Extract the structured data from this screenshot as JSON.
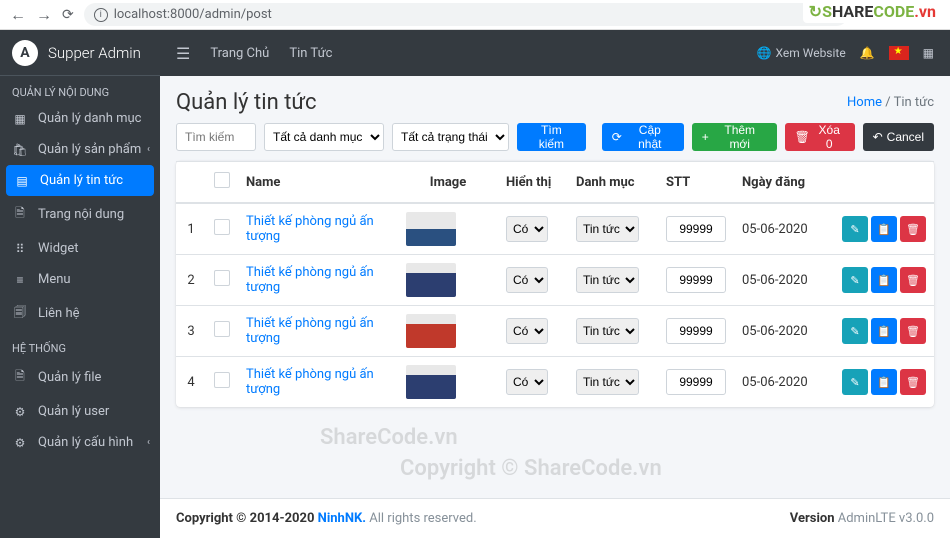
{
  "browser": {
    "url": "localhost:8000/admin/post"
  },
  "brand": "Supper Admin",
  "sidebar": {
    "section1": "QUẢN LÝ NỘI DUNG",
    "items1": [
      {
        "label": "Quản lý danh mục",
        "icon": "▦"
      },
      {
        "label": "Quản lý sản phẩm",
        "icon": "🛍",
        "chev": "‹"
      },
      {
        "label": "Quản lý tin tức",
        "icon": "▤",
        "active": true
      },
      {
        "label": "Trang nội dung",
        "icon": "🗎"
      },
      {
        "label": "Widget",
        "icon": "⠿"
      },
      {
        "label": "Menu",
        "icon": "≡"
      },
      {
        "label": "Liên hệ",
        "icon": "🗐"
      }
    ],
    "section2": "HỆ THỐNG",
    "items2": [
      {
        "label": "Quản lý file",
        "icon": "🗎"
      },
      {
        "label": "Quản lý user",
        "icon": "⚙"
      },
      {
        "label": "Quản lý cấu hình",
        "icon": "⚙",
        "chev": "‹"
      }
    ]
  },
  "topbar": {
    "links": [
      "Trang Chủ",
      "Tin Tức"
    ],
    "xem": "Xem Website"
  },
  "page": {
    "title": "Quản lý tin tức",
    "crumb_home": "Home",
    "crumb_current": "Tin tức"
  },
  "filters": {
    "search_ph": "Tìm kiếm",
    "cat": "Tất cả danh mục",
    "status": "Tất cả trạng thái",
    "search_btn": "Tìm kiếm",
    "update": "Cập nhật",
    "add": "Thêm mới",
    "del": "Xóa 0",
    "cancel": "Cancel"
  },
  "table": {
    "headers": [
      "",
      "",
      "Name",
      "Image",
      "Hiển thị",
      "Danh mục",
      "STT",
      "Ngày đăng",
      ""
    ],
    "rows": [
      {
        "idx": "1",
        "name": "Thiết kế phòng ngủ ấn tượng",
        "show": "Có",
        "cat": "Tin tức",
        "stt": "99999",
        "date": "05-06-2020",
        "thumb": "blue"
      },
      {
        "idx": "2",
        "name": "Thiết kế phòng ngủ ấn tượng",
        "show": "Có",
        "cat": "Tin tức",
        "stt": "99999",
        "date": "05-06-2020",
        "thumb": "navy"
      },
      {
        "idx": "3",
        "name": "Thiết kế phòng ngủ ấn tượng",
        "show": "Có",
        "cat": "Tin tức",
        "stt": "99999",
        "date": "05-06-2020",
        "thumb": "red"
      },
      {
        "idx": "4",
        "name": "Thiết kế phòng ngủ ấn tượng",
        "show": "Có",
        "cat": "Tin tức",
        "stt": "99999",
        "date": "05-06-2020",
        "thumb": "navy"
      }
    ]
  },
  "footer": {
    "copyright": "Copyright © 2014-2020 ",
    "author": "NinhNK.",
    "rights": " All rights reserved.",
    "version_label": "Version ",
    "version": "AdminLTE v3.0.0"
  },
  "watermark": "ShareCode.vn",
  "watermark2": "Copyright © ShareCode.vn"
}
